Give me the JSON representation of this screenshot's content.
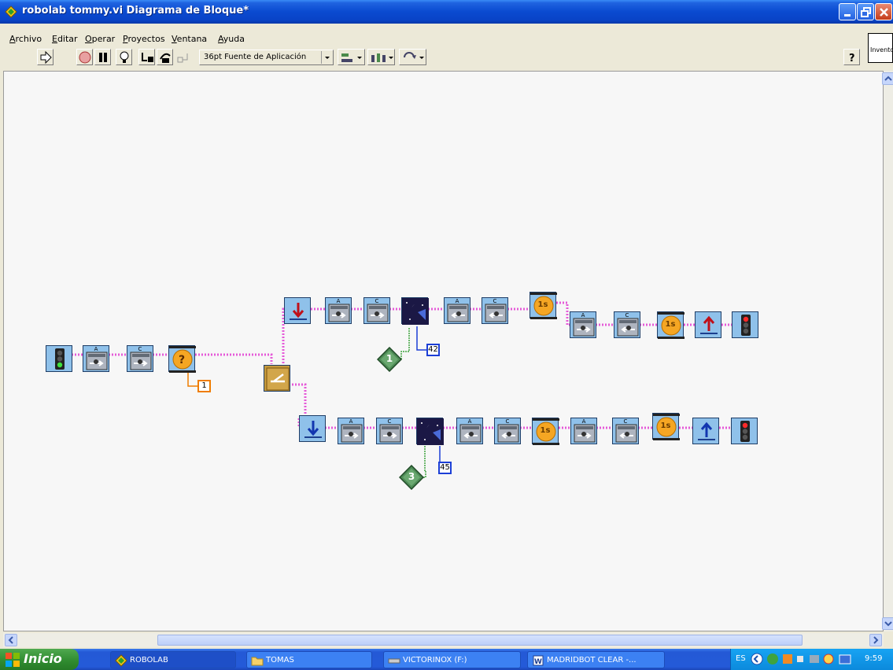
{
  "window": {
    "title": "robolab tommy.vi Diagrama de Bloque*"
  },
  "menu": [
    "Archivo",
    "Editar",
    "Operar",
    "Proyectos",
    "Ventana",
    "Ayuda"
  ],
  "toolbar": {
    "font_select": "36pt Fuente de Aplicación",
    "context_field": "Inventor"
  },
  "diagram": {
    "constants": {
      "fork_input": "1",
      "top_branch_sensor": "42",
      "bottom_branch_sensor": "45"
    },
    "containers": {
      "top_branch": "1",
      "bottom_branch": "3"
    },
    "port_labels": {
      "A": "A",
      "C": "C"
    },
    "timer_label": "1s",
    "question_label": "?"
  },
  "taskbar": {
    "start_label": "Inicio",
    "tasks": [
      "ROBOLAB",
      "TOMAS",
      "VICTORINOX (F:)",
      "MADRIDBOT CLEAR -..."
    ],
    "language": "ES",
    "clock": "9:59"
  }
}
